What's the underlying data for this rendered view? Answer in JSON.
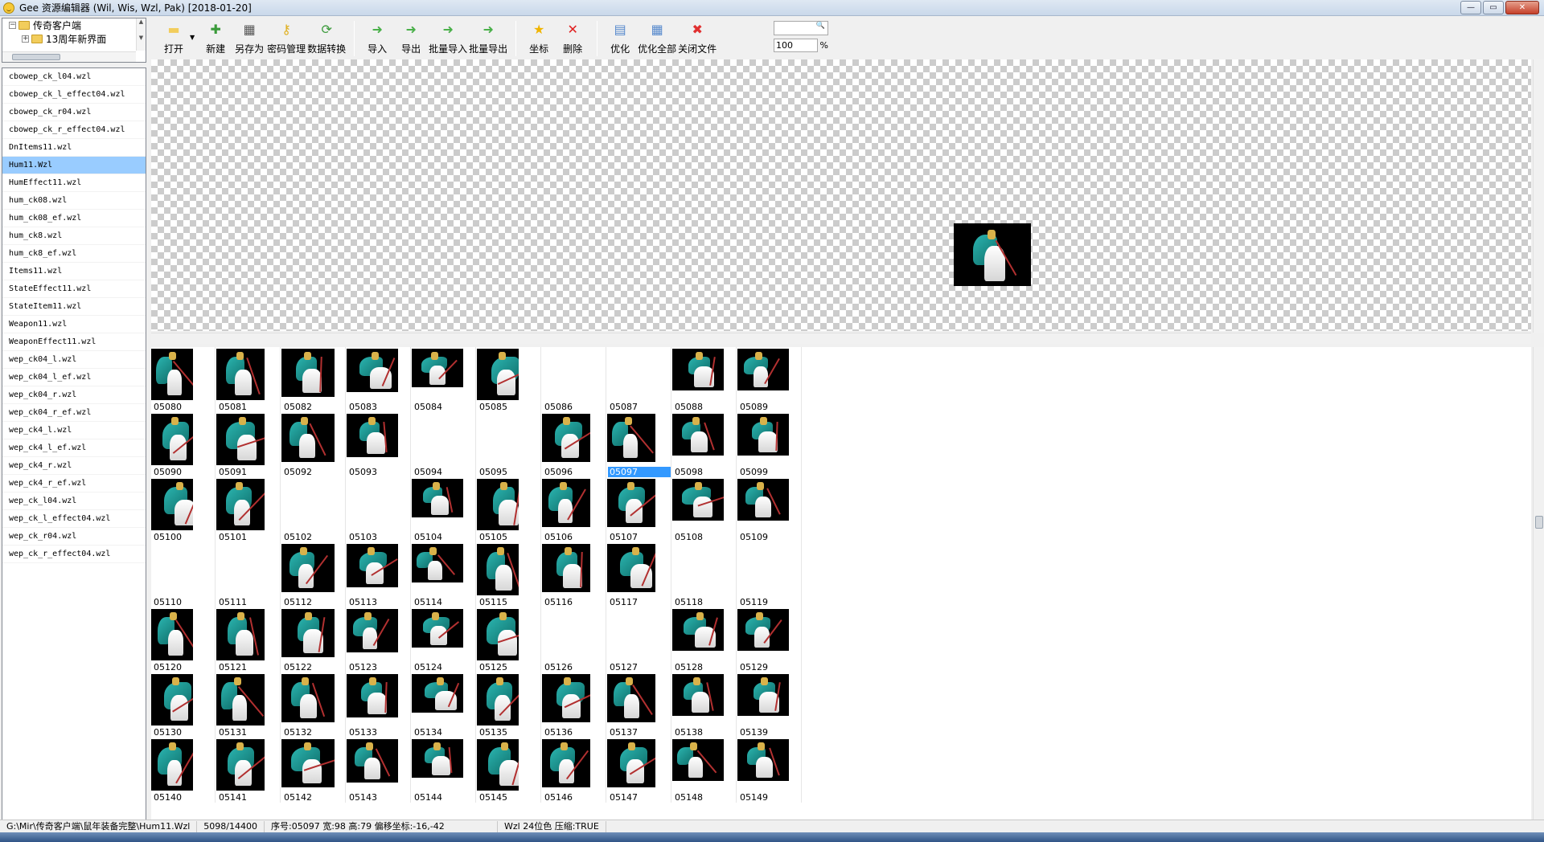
{
  "window": {
    "title": "Gee 资源编辑器 (Wil, Wis, Wzl, Pak) [2018-01-20]",
    "buttons": {
      "minimize": "—",
      "restore": "▭",
      "close": "✕"
    }
  },
  "tree": {
    "root": "传奇客户端",
    "child": "13周年新界面",
    "scroll_up": "▲",
    "scroll_down": "▼"
  },
  "toolbar": {
    "items": [
      {
        "label": "打开",
        "icon": "folder-icon",
        "color": "#f2cd5c"
      },
      {
        "label": "新建",
        "icon": "new-icon",
        "color": "#3a9a3a"
      },
      {
        "label": "另存为",
        "icon": "save-as-icon",
        "color": "#555555"
      },
      {
        "label": "密码管理",
        "icon": "key-icon",
        "color": "#e0b020"
      },
      {
        "label": "数据转换",
        "icon": "convert-icon",
        "color": "#3a9a3a"
      },
      {
        "label": "导入",
        "icon": "import-icon",
        "color": "#4ab04a"
      },
      {
        "label": "导出",
        "icon": "export-icon",
        "color": "#4ab04a"
      },
      {
        "label": "批量导入",
        "icon": "batch-import-icon",
        "color": "#4ab04a"
      },
      {
        "label": "批量导出",
        "icon": "batch-export-icon",
        "color": "#4ab04a"
      },
      {
        "label": "坐标",
        "icon": "star-icon",
        "color": "#f0b400"
      },
      {
        "label": "删除",
        "icon": "delete-icon",
        "color": "#e02020"
      },
      {
        "label": "优化",
        "icon": "optimize-icon",
        "color": "#5588cc"
      },
      {
        "label": "优化全部",
        "icon": "optimize-all-icon",
        "color": "#5588cc"
      },
      {
        "label": "关闭文件",
        "icon": "close-file-icon",
        "color": "#e03030"
      }
    ],
    "dropdown_arrow": "▼",
    "zoom_value": "100",
    "zoom_unit": "%",
    "search_icon": "🔍"
  },
  "files": [
    "cbowep_ck_l04.wzl",
    "cbowep_ck_l_effect04.wzl",
    "cbowep_ck_r04.wzl",
    "cbowep_ck_r_effect04.wzl",
    "DnItems11.wzl",
    "Hum11.Wzl",
    "HumEffect11.wzl",
    "hum_ck08.wzl",
    "hum_ck08_ef.wzl",
    "hum_ck8.wzl",
    "hum_ck8_ef.wzl",
    "Items11.wzl",
    "StateEffect11.wzl",
    "StateItem11.wzl",
    "Weapon11.wzl",
    "WeaponEffect11.wzl",
    "wep_ck04_l.wzl",
    "wep_ck04_l_ef.wzl",
    "wep_ck04_r.wzl",
    "wep_ck04_r_ef.wzl",
    "wep_ck4_l.wzl",
    "wep_ck4_l_ef.wzl",
    "wep_ck4_r.wzl",
    "wep_ck4_r_ef.wzl",
    "wep_ck_l04.wzl",
    "wep_ck_l_effect04.wzl",
    "wep_ck_r04.wzl",
    "wep_ck_r_effect04.wzl"
  ],
  "selected_file": "Hum11.Wzl",
  "frames": [
    "05080",
    "05081",
    "05082",
    "05083",
    "05084",
    "05085",
    "05086",
    "05087",
    "05088",
    "05089",
    "05090",
    "05091",
    "05092",
    "05093",
    "05094",
    "05095",
    "05096",
    "05097",
    "05098",
    "05099",
    "05100",
    "05101",
    "05102",
    "05103",
    "05104",
    "05105",
    "05106",
    "05107",
    "05108",
    "05109",
    "05110",
    "05111",
    "05112",
    "05113",
    "05114",
    "05115",
    "05116",
    "05117",
    "05118",
    "05119",
    "05120",
    "05121",
    "05122",
    "05123",
    "05124",
    "05125",
    "05126",
    "05127",
    "05128",
    "05129",
    "05130",
    "05131",
    "05132",
    "05133",
    "05134",
    "05135",
    "05136",
    "05137",
    "05138",
    "05139",
    "05140",
    "05141",
    "05142",
    "05143",
    "05144",
    "05145",
    "05146",
    "05147",
    "05148",
    "05149"
  ],
  "empty_frames": [
    "05086",
    "05087",
    "05094",
    "05095",
    "05102",
    "05103",
    "05110",
    "05111",
    "05118",
    "05119",
    "05126",
    "05127"
  ],
  "selected_frame": "05097",
  "status": {
    "path": "G:\\Mir\\传奇客户端\\鼠年装备完整\\Hum11.Wzl",
    "count": "5098/14400",
    "info": "序号:05097 宽:98 高:79 偏移坐标:-16,-42",
    "format": "Wzl 24位色 压缩:TRUE"
  }
}
